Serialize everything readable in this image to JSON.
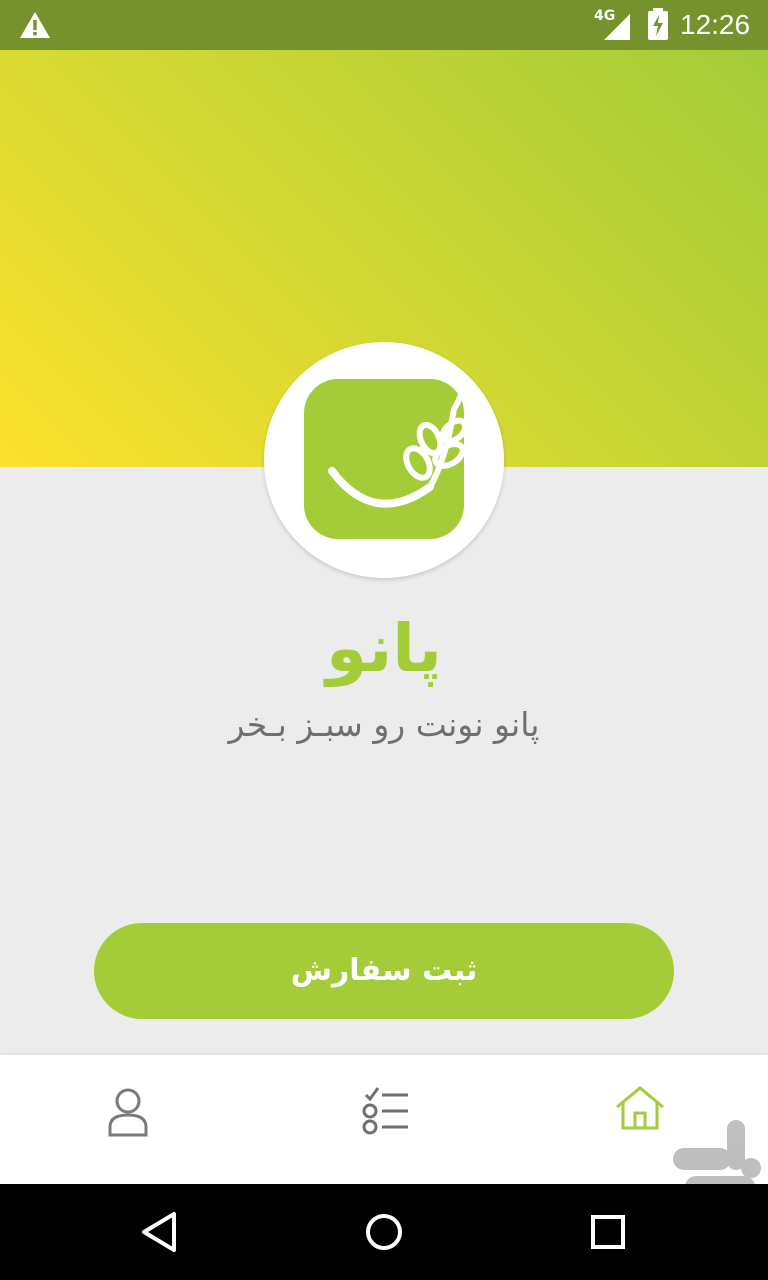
{
  "status_bar": {
    "network": "4G",
    "time": "12:26",
    "icons": [
      "warning-icon",
      "signal-icon",
      "battery-charging-icon"
    ]
  },
  "app": {
    "brand_name": "پانو",
    "tagline": "پانو نونت رو سبـز بـخر",
    "logo_icon": "wheat-logo-icon"
  },
  "actions": {
    "order_label": "ثبت سفارش"
  },
  "bottom_nav": {
    "items": [
      {
        "icon": "profile-icon"
      },
      {
        "icon": "orders-list-icon"
      },
      {
        "icon": "home-icon",
        "active": true
      }
    ]
  },
  "colors": {
    "accent": "#a3cc38",
    "status_bar": "#76922c",
    "gradient_start": "#fde12c",
    "gradient_end": "#a3cc38",
    "background": "#ececec"
  }
}
